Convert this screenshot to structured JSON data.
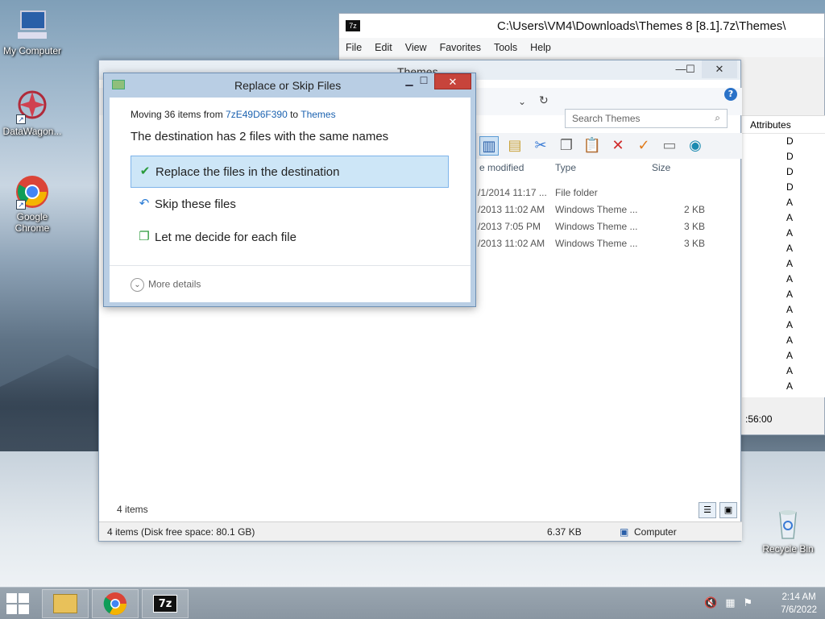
{
  "desktop": {
    "icons": [
      {
        "label": "My Computer"
      },
      {
        "label": "DataWagon..."
      },
      {
        "label": "Google Chrome"
      },
      {
        "label": "Recycle Bin"
      }
    ]
  },
  "sevenzip_window": {
    "title": "C:\\Users\\VM4\\Downloads\\Themes 8 [8.1].7z\\Themes\\",
    "icon_text": "7z",
    "menu": [
      "File",
      "Edit",
      "View",
      "Favorites",
      "Tools",
      "Help"
    ],
    "attributes_header": "Attributes",
    "attributes": [
      "D",
      "D",
      "D",
      "D",
      "A",
      "A",
      "A",
      "A",
      "A",
      "A",
      "A",
      "A",
      "A",
      "A",
      "A",
      "A",
      "A"
    ],
    "time_text": ":56:00"
  },
  "explorer_window": {
    "title": "Themes",
    "search_placeholder": "Search Themes",
    "columns": {
      "date": "e modified",
      "type": "Type",
      "size": "Size"
    },
    "rows": [
      {
        "date": "/1/2014 11:17 ...",
        "type": "File folder",
        "size": ""
      },
      {
        "date": "/2013 11:02 AM",
        "type": "Windows Theme ...",
        "size": "2 KB"
      },
      {
        "date": "/2013 7:05 PM",
        "type": "Windows Theme ...",
        "size": "3 KB"
      },
      {
        "date": "/2013 11:02 AM",
        "type": "Windows Theme ...",
        "size": "3 KB"
      }
    ],
    "item_count": "4 items",
    "status": {
      "left": "4 items (Disk free space: 80.1 GB)",
      "size": "6.37 KB",
      "location": "Computer"
    }
  },
  "dialog": {
    "title": "Replace or Skip Files",
    "moving_prefix": "Moving 36 items from ",
    "source": "7zE49D6F390",
    "to": " to ",
    "destination": "Themes",
    "message": "The destination has 2 files with the same names",
    "options": [
      {
        "label": "Replace the files in the destination",
        "icon": "check-icon"
      },
      {
        "label": "Skip these files",
        "icon": "skip-arrow-icon"
      },
      {
        "label": "Let me decide for each file",
        "icon": "decide-icon"
      }
    ],
    "more_details": "More details"
  },
  "taskbar": {
    "time": "2:14 AM",
    "date": "7/6/2022",
    "apps": [
      "File Explorer",
      "Google Chrome",
      "7-Zip"
    ]
  }
}
